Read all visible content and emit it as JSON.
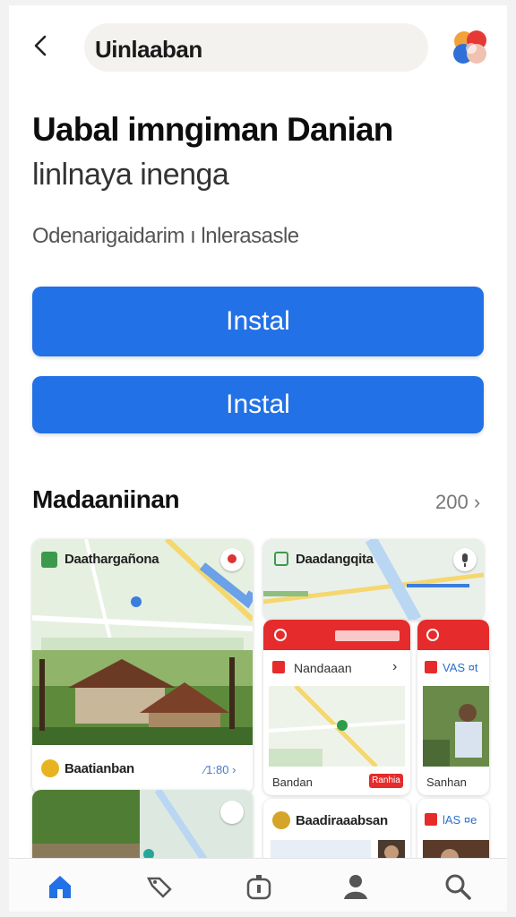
{
  "header": {
    "search_text": "Uinlaaban"
  },
  "app": {
    "title": "Uabal imngiman Danian",
    "subtitle": "linlnaya inenga",
    "description": "Odenarigaidarim ı lnlerasasle"
  },
  "buttons": {
    "install_primary": "Instal",
    "install_secondary": "Instal"
  },
  "section": {
    "title": "Madaaniinan",
    "count": "200 ›"
  },
  "cards": {
    "card_a": {
      "header_label": "Daathargañona",
      "footer_label": "Baatianban",
      "footer_value": "⁄1:80 ›"
    },
    "card_c": {
      "header_label": "Daadangqita"
    },
    "card_d": {
      "row_label": "Nandaaan",
      "footer_label": "Bandan",
      "red_chip": "Ranhia"
    },
    "card_e": {
      "row_label": "VAS ¤t",
      "footer_label": "Sanhan"
    },
    "card_f": {
      "header_label": "Baadiraaabsan"
    },
    "card_g": {
      "row_label": "lAS ¤e"
    }
  },
  "colors": {
    "accent": "#2271e6",
    "red": "#e52b2b",
    "map_green": "#d8ecd2",
    "map_water": "#b9d6f2"
  },
  "nav": {
    "items": [
      "home-icon",
      "tag-icon",
      "bag-icon",
      "profile-icon",
      "search-icon"
    ]
  }
}
